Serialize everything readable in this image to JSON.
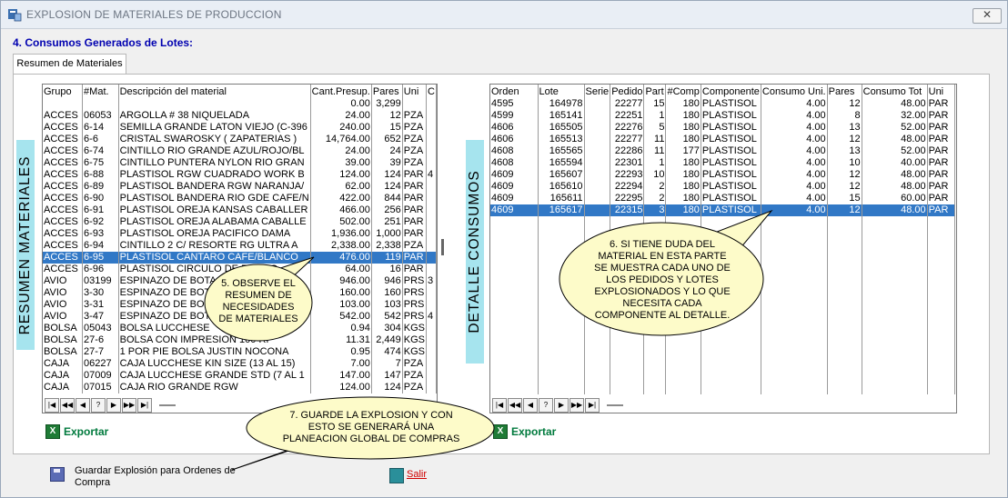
{
  "window": {
    "title": "EXPLOSION DE MATERIALES DE PRODUCCION",
    "close_glyph": "✕"
  },
  "section_title": "4. Consumos Generados de Lotes:",
  "tab": {
    "label": "Resumen de Materiales"
  },
  "left_panel": {
    "vertical_label": "RESUMEN MATERIALES",
    "columns": [
      "Grupo",
      "#Mat.",
      "Descripción del material",
      "Cant.Presup.",
      "Pares",
      "Uni",
      "C"
    ],
    "rows": [
      [
        "",
        "",
        "",
        "0.00",
        "3,299",
        "",
        ""
      ],
      [
        "ACCES",
        "06053",
        "ARGOLLA # 38 NIQUELADA",
        "24.00",
        "12",
        "PZA",
        ""
      ],
      [
        "ACCES",
        "6-14",
        "SEMILLA GRANDE LATON VIEJO (C-396",
        "240.00",
        "15",
        "PZA",
        ""
      ],
      [
        "ACCES",
        "6-6",
        "CRISTAL SWAROSKY ( ZAPATERIAS )",
        "14,764.00",
        "652",
        "PZA",
        ""
      ],
      [
        "ACCES",
        "6-74",
        "CINTILLO RIO GRANDE AZUL/ROJO/BL",
        "24.00",
        "24",
        "PZA",
        ""
      ],
      [
        "ACCES",
        "6-75",
        "CINTILLO PUNTERA NYLON RIO GRAN",
        "39.00",
        "39",
        "PZA",
        ""
      ],
      [
        "ACCES",
        "6-88",
        "PLASTISOL RGW CUADRADO  WORK B",
        "124.00",
        "124",
        "PAR",
        "4"
      ],
      [
        "ACCES",
        "6-89",
        "PLASTISOL BANDERA RGW NARANJA/",
        "62.00",
        "124",
        "PAR",
        ""
      ],
      [
        "ACCES",
        "6-90",
        "PLASTISOL BANDERA RIO GDE CAFE/N",
        "422.00",
        "844",
        "PAR",
        ""
      ],
      [
        "ACCES",
        "6-91",
        "PLASTISOL OREJA KANSAS CABALLER",
        "466.00",
        "256",
        "PAR",
        ""
      ],
      [
        "ACCES",
        "6-92",
        "PLASTISOL OREJA ALABAMA CABALLE",
        "502.00",
        "251",
        "PAR",
        ""
      ],
      [
        "ACCES",
        "6-93",
        "PLASTISOL OREJA PACIFICO DAMA",
        "1,936.00",
        "1,000",
        "PAR",
        ""
      ],
      [
        "ACCES",
        "6-94",
        "CINTILLO  2 C/ RESORTE RG ULTRA  A",
        "2,338.00",
        "2,338",
        "PZA",
        ""
      ],
      [
        "ACCES",
        "6-95",
        "PLASTISOL CANTARO CAFE/BLANCO",
        "476.00",
        "119",
        "PAR",
        ""
      ],
      [
        "ACCES",
        "6-96",
        "PLASTISOL CIRCULO DE RODEO",
        "64.00",
        "16",
        "PAR",
        ""
      ],
      [
        "AVIO",
        "03199",
        "ESPINAZO DE BOTA",
        "946.00",
        "946",
        "PRS",
        "3"
      ],
      [
        "AVIO",
        "3-30",
        "ESPINAZO DE BOTA",
        "160.00",
        "160",
        "PRS",
        ""
      ],
      [
        "AVIO",
        "3-31",
        "ESPINAZO DE BOTA",
        "103.00",
        "103",
        "PRS",
        ""
      ],
      [
        "AVIO",
        "3-47",
        "ESPINAZO DE BOTA",
        "542.00",
        "542",
        "PRS",
        "4"
      ],
      [
        "BOLSA",
        "05043",
        "BOLSA LUCCHESE",
        "0.94",
        "304",
        "KGS",
        ""
      ],
      [
        "BOLSA",
        "27-6",
        "BOLSA CON IMPRESION 100 RI",
        "11.31",
        "2,449",
        "KGS",
        ""
      ],
      [
        "BOLSA",
        "27-7",
        "1 POR PIE BOLSA  JUSTIN  NOCONA",
        "0.95",
        "474",
        "KGS",
        ""
      ],
      [
        "CAJA",
        "06227",
        "CAJA LUCCHESE KIN SIZE (13 AL 15)",
        "7.00",
        "7",
        "PZA",
        ""
      ],
      [
        "CAJA",
        "07009",
        "CAJA LUCCHESE GRANDE STD (7 AL 1",
        "147.00",
        "147",
        "PZA",
        ""
      ],
      [
        "CAJA",
        "07015",
        "CAJA RIO GRANDE RGW",
        "124.00",
        "124",
        "PZA",
        ""
      ]
    ],
    "selected_row": 13,
    "export_label": "Exportar"
  },
  "right_panel": {
    "vertical_label": "DETALLE CONSUMOS",
    "columns": [
      "Orden",
      "Lote",
      "Serie",
      "Pedido",
      "Part",
      "#Comp",
      "Componente",
      "Consumo Uni.",
      "Pares",
      "Consumo Tot",
      "Uni"
    ],
    "rows": [
      [
        "4595",
        "164978",
        "",
        "22277",
        "15",
        "180",
        "PLASTISOL",
        "4.00",
        "12",
        "48.00",
        "PAR"
      ],
      [
        "4599",
        "165141",
        "",
        "22251",
        "1",
        "180",
        "PLASTISOL",
        "4.00",
        "8",
        "32.00",
        "PAR"
      ],
      [
        "4606",
        "165505",
        "",
        "22276",
        "5",
        "180",
        "PLASTISOL",
        "4.00",
        "13",
        "52.00",
        "PAR"
      ],
      [
        "4606",
        "165513",
        "",
        "22277",
        "11",
        "180",
        "PLASTISOL",
        "4.00",
        "12",
        "48.00",
        "PAR"
      ],
      [
        "4608",
        "165565",
        "",
        "22286",
        "11",
        "177",
        "PLASTISOL",
        "4.00",
        "13",
        "52.00",
        "PAR"
      ],
      [
        "4608",
        "165594",
        "",
        "22301",
        "1",
        "180",
        "PLASTISOL",
        "4.00",
        "10",
        "40.00",
        "PAR"
      ],
      [
        "4609",
        "165607",
        "",
        "22293",
        "10",
        "180",
        "PLASTISOL",
        "4.00",
        "12",
        "48.00",
        "PAR"
      ],
      [
        "4609",
        "165610",
        "",
        "22294",
        "2",
        "180",
        "PLASTISOL",
        "4.00",
        "12",
        "48.00",
        "PAR"
      ],
      [
        "4609",
        "165611",
        "",
        "22295",
        "2",
        "180",
        "PLASTISOL",
        "4.00",
        "15",
        "60.00",
        "PAR"
      ],
      [
        "4609",
        "165617",
        "",
        "22315",
        "3",
        "180",
        "PLASTISOL",
        "4.00",
        "12",
        "48.00",
        "PAR"
      ]
    ],
    "selected_row": 9,
    "export_label": "Exportar"
  },
  "navigator": {
    "buttons": [
      "|◀",
      "◀◀",
      "◀",
      "?",
      "▶",
      "▶▶",
      "▶|"
    ]
  },
  "callouts": {
    "c5": [
      "5. OBSERVE EL",
      "RESUMEN DE",
      "NECESIDADES",
      "DE MATERIALES"
    ],
    "c6": [
      "6. SI TIENE DUDA DEL",
      "MATERIAL EN ESTA PARTE",
      "SE MUESTRA CADA UNO DE",
      "LOS PEDIDOS Y LOTES",
      "EXPLOSIONADOS Y LO QUE",
      "NECESITA CADA",
      "COMPONENTE AL DETALLE."
    ],
    "c7": [
      "7. GUARDE LA EXPLOSION Y CON",
      "ESTO SE GENERARÁ UNA",
      "PLANEACION GLOBAL DE COMPRAS"
    ]
  },
  "footer": {
    "save_label": "Guardar Explosión para Ordenes de Compra",
    "exit_label": "Salir"
  },
  "colors": {
    "selection": "#3178c6",
    "vertical_label_bg": "#a6e4ee",
    "callout_fill": "#fdfbc9",
    "section_title": "#0000b0",
    "export_text": "#007a3d",
    "exit_text": "#d00000"
  }
}
